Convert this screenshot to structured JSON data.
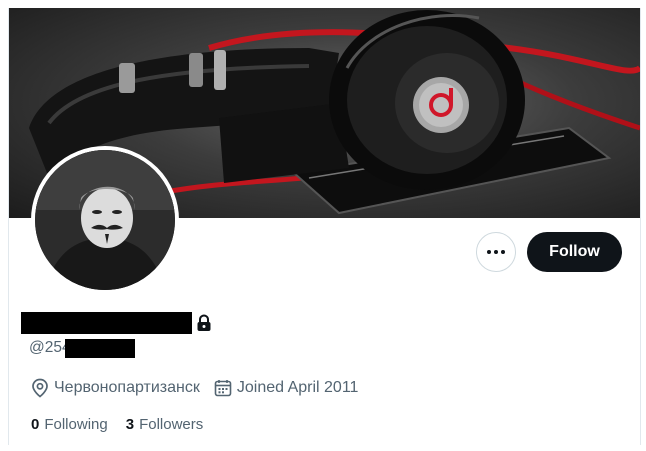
{
  "profile": {
    "display_name": "",
    "handle_prefix": "@254",
    "location": "Червонопартизанск",
    "joined": "Joined April 2011"
  },
  "actions": {
    "follow_label": "Follow"
  },
  "counts": {
    "following_count": "0",
    "following_label": "Following",
    "followers_count": "3",
    "followers_label": "Followers"
  },
  "icons": {
    "more": "more-horizontal-icon",
    "lock": "lock-icon",
    "location": "location-pin-icon",
    "calendar": "calendar-icon"
  },
  "colors": {
    "text_primary": "#0f1419",
    "text_secondary": "#536471",
    "follow_bg": "#0f1419",
    "accent_red": "#d0172a"
  }
}
